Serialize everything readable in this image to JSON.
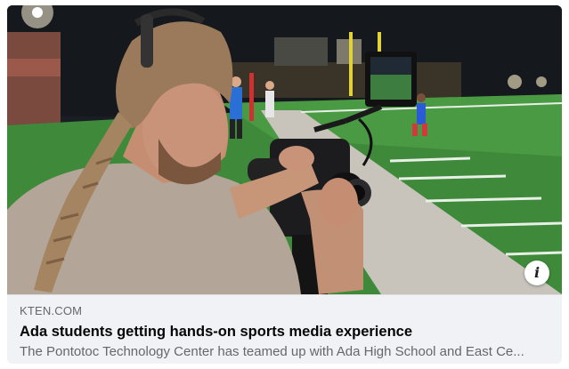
{
  "link_preview": {
    "domain": "KTEN.COM",
    "title": "Ada students getting hands-on sports media experience",
    "description": "The Pontotoc Technology Center has teamed up with Ada High School and East Ce...",
    "info_icon": "info-icon",
    "image_subject": "photo-camera-operator-football-field"
  },
  "colors": {
    "card_background": "#f0f2f5",
    "title_text": "#050505",
    "secondary_text": "#65676b",
    "field_green": "#3f8a3a"
  }
}
